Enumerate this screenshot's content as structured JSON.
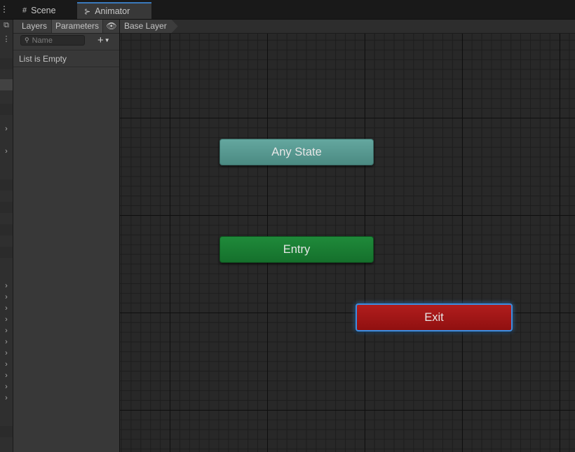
{
  "tabs": [
    {
      "label": "Scene",
      "icon": "grid-icon"
    },
    {
      "label": "Animator",
      "icon": "animator-icon"
    }
  ],
  "parameters_panel": {
    "tabs": [
      {
        "label": "Layers"
      },
      {
        "label": "Parameters"
      }
    ],
    "visibility_icon": "eye-icon",
    "search": {
      "placeholder": "Name",
      "value": ""
    },
    "add_icon": "plus-icon",
    "empty_text": "List is Empty"
  },
  "breadcrumb": {
    "label": "Base Layer"
  },
  "graph": {
    "nodes": [
      {
        "label": "Any State",
        "color": "#5a9e96"
      },
      {
        "label": "Entry",
        "color": "#1a7d33"
      },
      {
        "label": "Exit",
        "color": "#a31616",
        "selected": true
      }
    ],
    "selection_color": "#3d8ee0"
  },
  "colors": {
    "accent": "#3a79bb",
    "background": "#282828"
  }
}
